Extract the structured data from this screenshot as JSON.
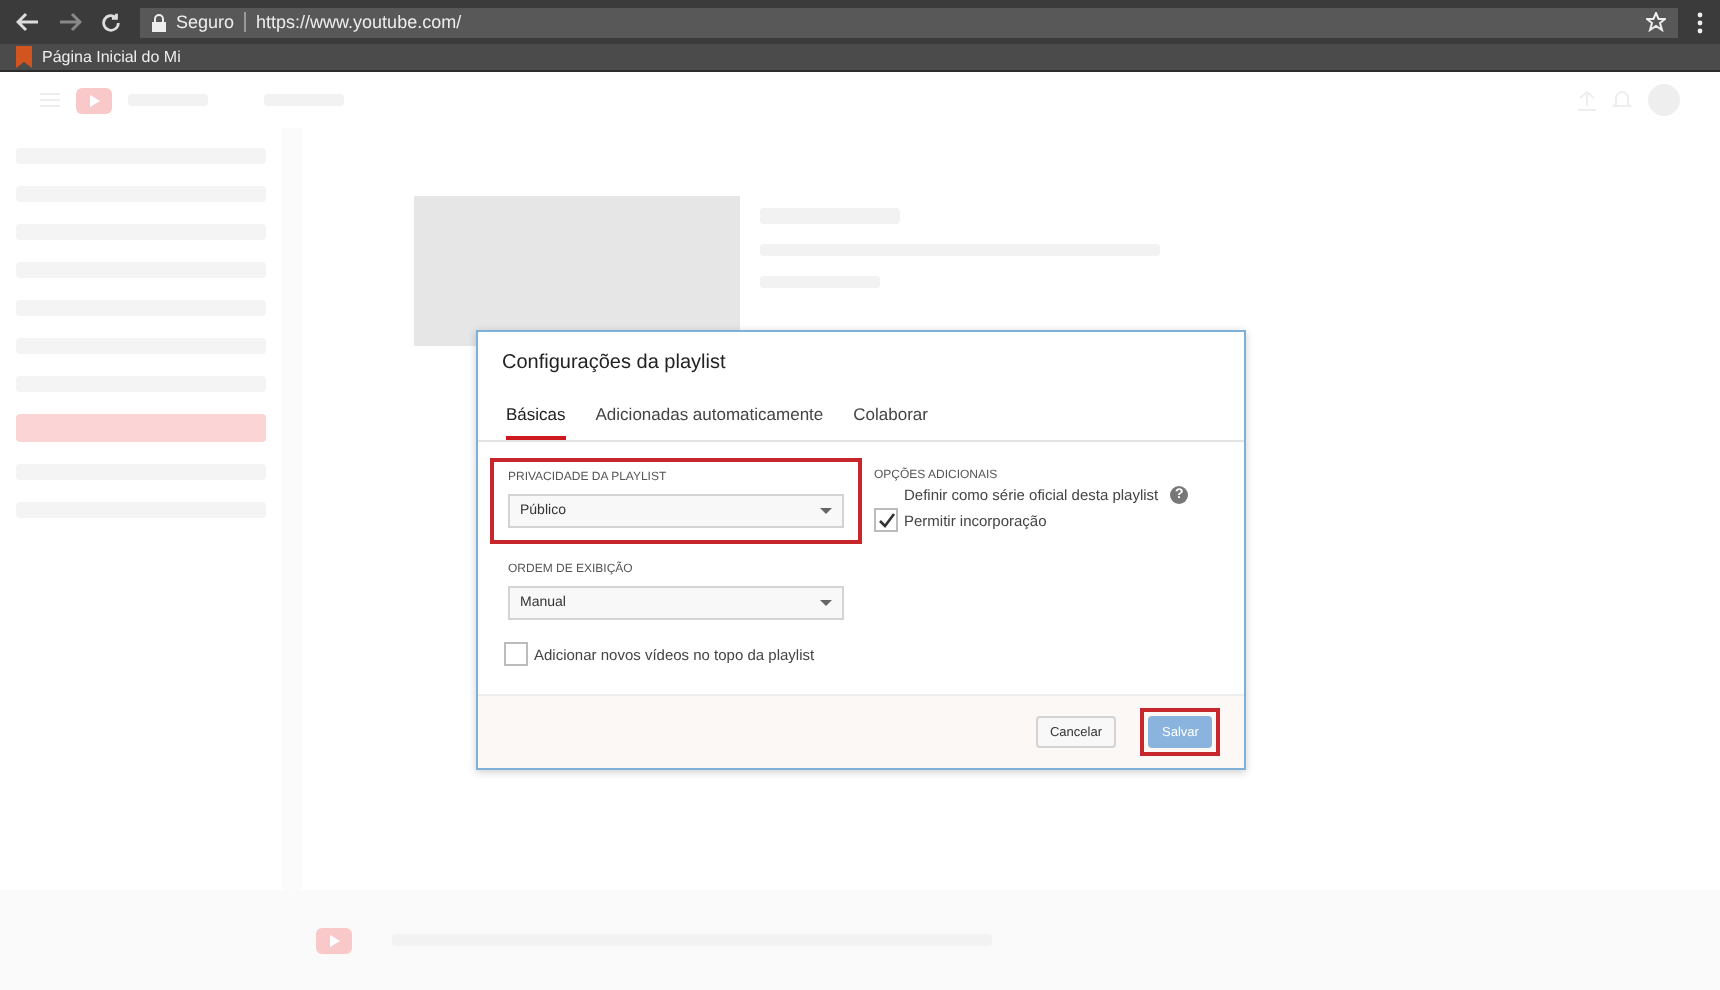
{
  "sidebar": {
    "items": [
      {
        "selected": false
      },
      {
        "selected": false
      },
      {
        "selected": false
      },
      {
        "selected": false
      },
      {
        "selected": false
      },
      {
        "selected": false
      },
      {
        "selected": false
      },
      {
        "selected": true
      },
      {
        "selected": false
      },
      {
        "selected": false
      }
    ]
  },
  "browser": {
    "security": "Seguro",
    "url": "https://www.youtube.com/",
    "bookmark": "Página Inicial do Mi"
  },
  "dialog": {
    "title": "Configurações da playlist",
    "tabs": [
      {
        "label": "Básicas",
        "selected": true
      },
      {
        "label": "Adicionadas automaticamente",
        "selected": false
      },
      {
        "label": "Colaborar",
        "selected": false
      }
    ],
    "privacy": {
      "label": "PRIVACIDADE DA PLAYLIST",
      "value": "Público",
      "highlighted": true
    },
    "order": {
      "label": "ORDEM DE EXIBIÇÃO",
      "value": "Manual"
    },
    "add_to_top": {
      "label": "Adicionar novos vídeos no topo da playlist",
      "checked": false
    },
    "additional": {
      "label": "OPÇÕES ADICIONAIS",
      "options": [
        {
          "kind": "plain",
          "label": "Definir como série oficial desta playlist",
          "help": "?"
        },
        {
          "kind": "checkbox",
          "label": "Permitir incorporação",
          "checked": true
        }
      ]
    },
    "buttons": [
      {
        "label": "Cancelar",
        "kind": "secondary",
        "highlighted": false
      },
      {
        "label": "Salvar",
        "kind": "primary",
        "highlighted": true
      }
    ]
  }
}
